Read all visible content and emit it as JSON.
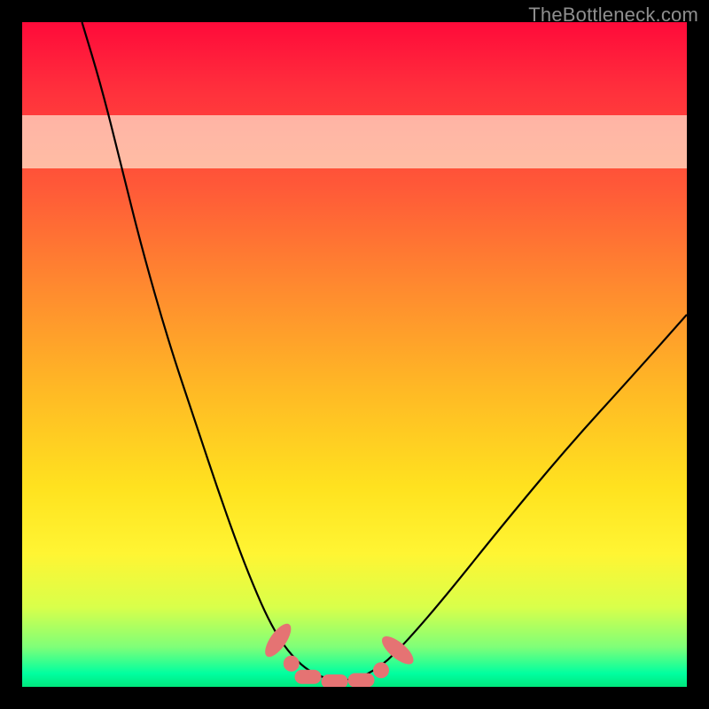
{
  "watermark": "TheBottleneck.com",
  "chart_data": {
    "type": "line",
    "title": "",
    "xlabel": "",
    "ylabel": "",
    "xlim": [
      0,
      100
    ],
    "ylim": [
      0,
      100
    ],
    "band": {
      "y_start": 78,
      "y_end": 86
    },
    "series": [
      {
        "name": "curve",
        "points": [
          {
            "x": 9,
            "y": 100
          },
          {
            "x": 12,
            "y": 90
          },
          {
            "x": 15,
            "y": 78
          },
          {
            "x": 18,
            "y": 66
          },
          {
            "x": 22,
            "y": 52
          },
          {
            "x": 26,
            "y": 40
          },
          {
            "x": 30,
            "y": 28
          },
          {
            "x": 34,
            "y": 17
          },
          {
            "x": 38,
            "y": 8
          },
          {
            "x": 42,
            "y": 3
          },
          {
            "x": 46,
            "y": 1
          },
          {
            "x": 50,
            "y": 1
          },
          {
            "x": 54,
            "y": 3
          },
          {
            "x": 58,
            "y": 7
          },
          {
            "x": 64,
            "y": 14
          },
          {
            "x": 72,
            "y": 24
          },
          {
            "x": 82,
            "y": 36
          },
          {
            "x": 92,
            "y": 47
          },
          {
            "x": 100,
            "y": 56
          }
        ]
      }
    ],
    "markers": [
      {
        "x": 38.5,
        "y": 7.0,
        "shape": "tilted-oval"
      },
      {
        "x": 40.5,
        "y": 3.5,
        "shape": "dot"
      },
      {
        "x": 43.0,
        "y": 1.5,
        "shape": "bar"
      },
      {
        "x": 47.0,
        "y": 0.8,
        "shape": "bar"
      },
      {
        "x": 51.0,
        "y": 1.0,
        "shape": "bar"
      },
      {
        "x": 54.0,
        "y": 2.5,
        "shape": "dot"
      },
      {
        "x": 56.5,
        "y": 5.5,
        "shape": "tilted-oval-r"
      }
    ]
  }
}
